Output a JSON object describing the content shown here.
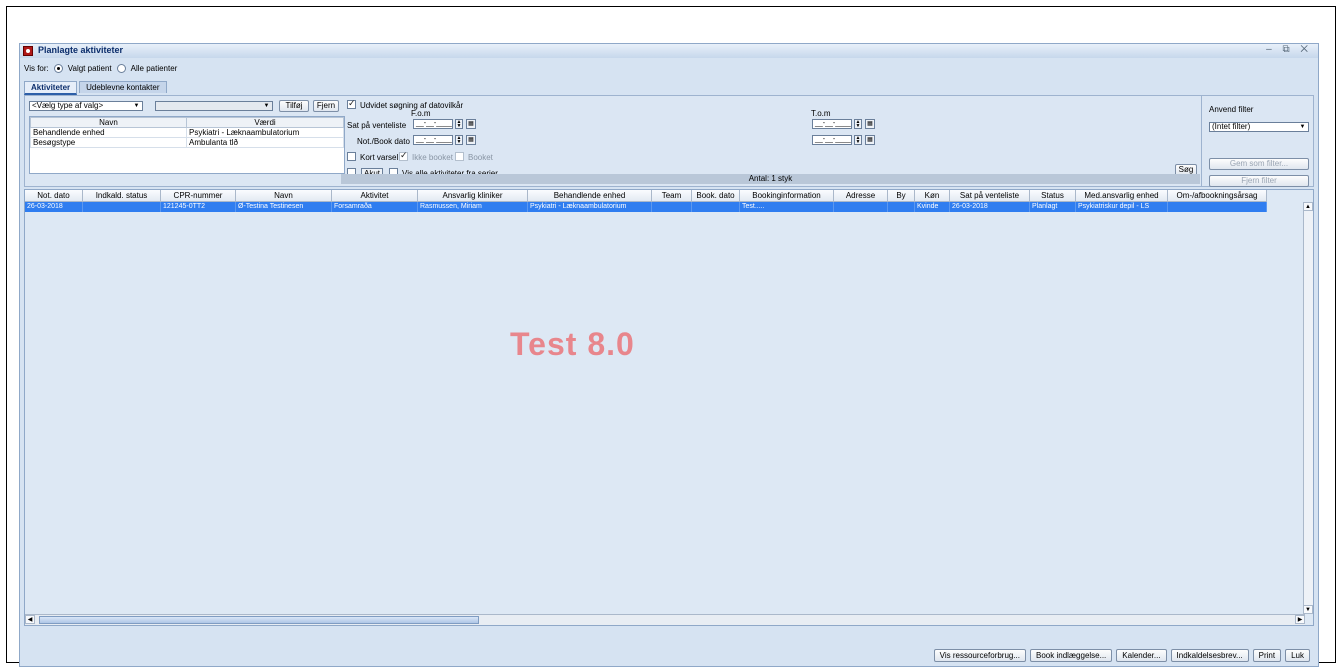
{
  "window": {
    "title": "Planlagte aktiviteter",
    "controls": "– ⧉ ✕"
  },
  "vis_for": {
    "label": "Vis for:",
    "options": [
      "Valgt patient",
      "Alle patienter"
    ],
    "selected": "Valgt patient"
  },
  "tabs": [
    "Aktiviteter",
    "Udeblevne kontakter"
  ],
  "criteria": {
    "type_select": "<Vælg type af valg>",
    "value_select": "",
    "add_button": "Tilføj",
    "remove_button": "Fjern",
    "columns": [
      "Navn",
      "Værdi"
    ],
    "rows": [
      {
        "name": "Behandlende enhed",
        "value": "Psykiatri - Læknaambulatorium"
      },
      {
        "name": "Besøgstype",
        "value": "Ambulanta tlð"
      }
    ]
  },
  "dates": {
    "extended_label": "Udvidet søgning af datovilkår",
    "from_label": "F.o.m",
    "to_label": "T.o.m",
    "row1_label": "Sat på venteliste",
    "row2_label": "Not./Book dato",
    "placeholder": "__-__-____"
  },
  "flags": {
    "kort_varsel": "Kort varsel",
    "ikke_booket": "Ikke booket",
    "booket": "Booket",
    "akut": "Akut",
    "vis_alle": "Vis alle aktiviteter fra serier",
    "search_button": "Søg"
  },
  "count": "Antal: 1 styk",
  "filter": {
    "label": "Anvend filter",
    "selected": "(Intet filter)",
    "save_button": "Gem som filter...",
    "remove_button": "Fjern filter"
  },
  "grid": {
    "columns": [
      "Not. dato",
      "Indkald. status",
      "CPR-nummer",
      "Navn",
      "Aktivitet",
      "Ansvarlig kliniker",
      "Behandlende enhed",
      "Team",
      "Book. dato",
      "Bookinginformation",
      "Adresse",
      "By",
      "Køn",
      "Sat på venteliste",
      "Status",
      "Med.ansvarlig enhed",
      "Om-/afbookningsårsag"
    ],
    "rows": [
      [
        "26-03-2018",
        "",
        "121245-0TT2",
        "Ø-Testina Testinesen",
        "Forsamraða",
        "Rasmussen, Miriam",
        "Psykiatri - Læknaambulatorium",
        "",
        "",
        "Test.....",
        "",
        "",
        "Kvinde",
        "26-03-2018",
        "Planlagt",
        "Psykiatriskur depil - LS",
        ""
      ]
    ]
  },
  "watermark": "Test 8.0",
  "footer": [
    "Vis ressourceforbrug...",
    "Book indlæggelse...",
    "Kalender...",
    "Indkaldelsesbrev...",
    "Print",
    "Luk"
  ]
}
